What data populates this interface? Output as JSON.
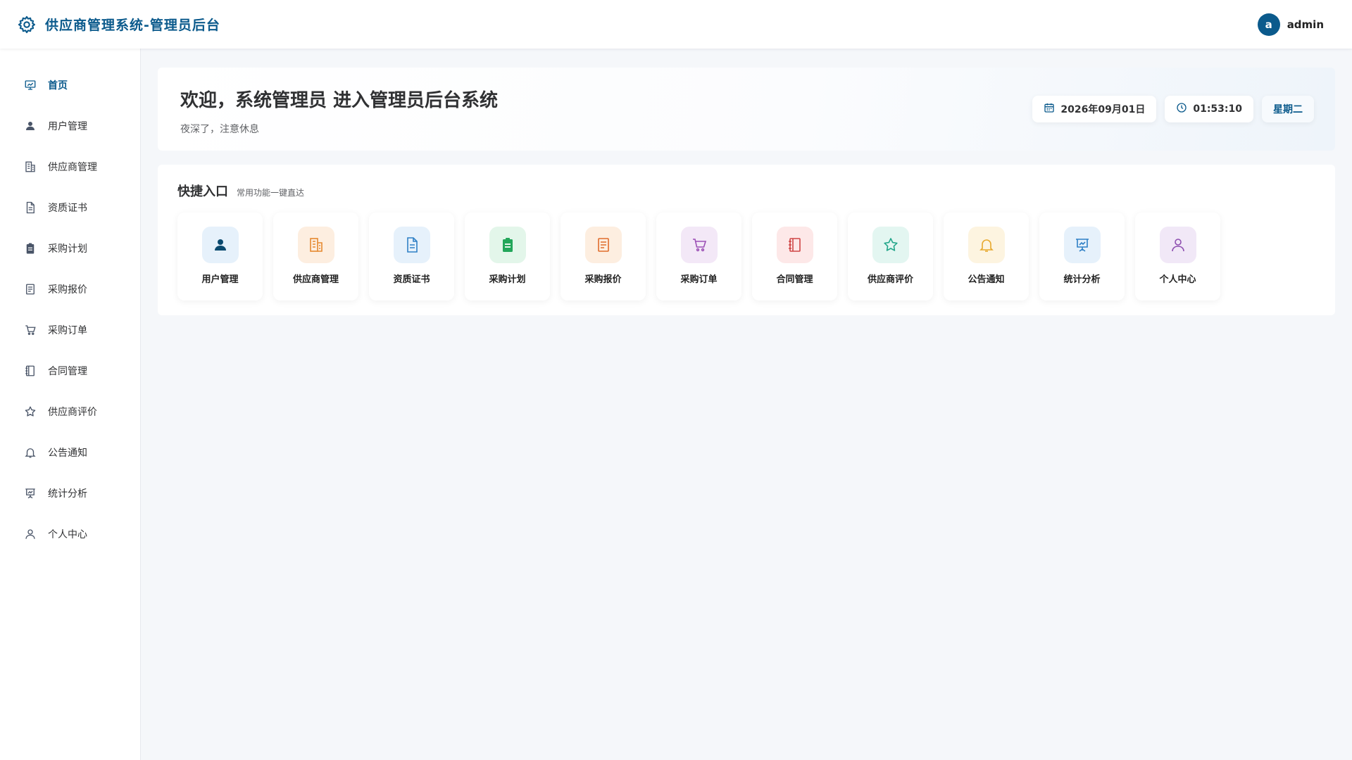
{
  "header": {
    "title": "供应商管理系统-管理员后台",
    "logo_icon": "gear-icon",
    "avatar_letter": "a",
    "username": "admin",
    "accent": "#0b5a8c"
  },
  "sidebar": {
    "items": [
      {
        "label": "首页",
        "icon": "chart-board-icon",
        "active": true
      },
      {
        "label": "用户管理",
        "icon": "user-filled-icon"
      },
      {
        "label": "供应商管理",
        "icon": "building-icon"
      },
      {
        "label": "资质证书",
        "icon": "document-icon"
      },
      {
        "label": "采购计划",
        "icon": "clipboard-icon"
      },
      {
        "label": "采购报价",
        "icon": "list-doc-icon"
      },
      {
        "label": "采购订单",
        "icon": "cart-icon"
      },
      {
        "label": "合同管理",
        "icon": "notebook-icon"
      },
      {
        "label": "供应商评价",
        "icon": "star-icon"
      },
      {
        "label": "公告通知",
        "icon": "bell-icon"
      },
      {
        "label": "统计分析",
        "icon": "presentation-icon"
      },
      {
        "label": "个人中心",
        "icon": "user-outline-icon"
      }
    ]
  },
  "welcome": {
    "title": "欢迎，系统管理员 进入管理员后台系统",
    "subtitle": "夜深了，注意休息",
    "date": "2026年09月01日",
    "time": "01:53:10",
    "weekday": "星期二"
  },
  "quick": {
    "title": "快捷入口",
    "subtitle": "常用功能一键直达",
    "cards": [
      {
        "label": "用户管理",
        "icon": "user-filled-icon",
        "bg": "#e6f1fb",
        "fg": "#0b4a6f"
      },
      {
        "label": "供应商管理",
        "icon": "building-icon",
        "bg": "#fdeee0",
        "fg": "#e6892f"
      },
      {
        "label": "资质证书",
        "icon": "document-icon",
        "bg": "#e6f1fb",
        "fg": "#2f80c6"
      },
      {
        "label": "采购计划",
        "icon": "clipboard-icon",
        "bg": "#e3f6ea",
        "fg": "#23a65a"
      },
      {
        "label": "采购报价",
        "icon": "list-doc-icon",
        "bg": "#fdeee0",
        "fg": "#e06d2c"
      },
      {
        "label": "采购订单",
        "icon": "cart-icon",
        "bg": "#f3e8f7",
        "fg": "#9b4fb5"
      },
      {
        "label": "合同管理",
        "icon": "notebook-icon",
        "bg": "#fde8e8",
        "fg": "#d04545"
      },
      {
        "label": "供应商评价",
        "icon": "star-icon",
        "bg": "#e3f6f1",
        "fg": "#23a68a"
      },
      {
        "label": "公告通知",
        "icon": "bell-icon",
        "bg": "#fdf4e0",
        "fg": "#e8a92e"
      },
      {
        "label": "统计分析",
        "icon": "presentation-icon",
        "bg": "#e6f1fb",
        "fg": "#2f80c6"
      },
      {
        "label": "个人中心",
        "icon": "user-outline-icon",
        "bg": "#f1e8f7",
        "fg": "#8e4fb0"
      }
    ]
  }
}
